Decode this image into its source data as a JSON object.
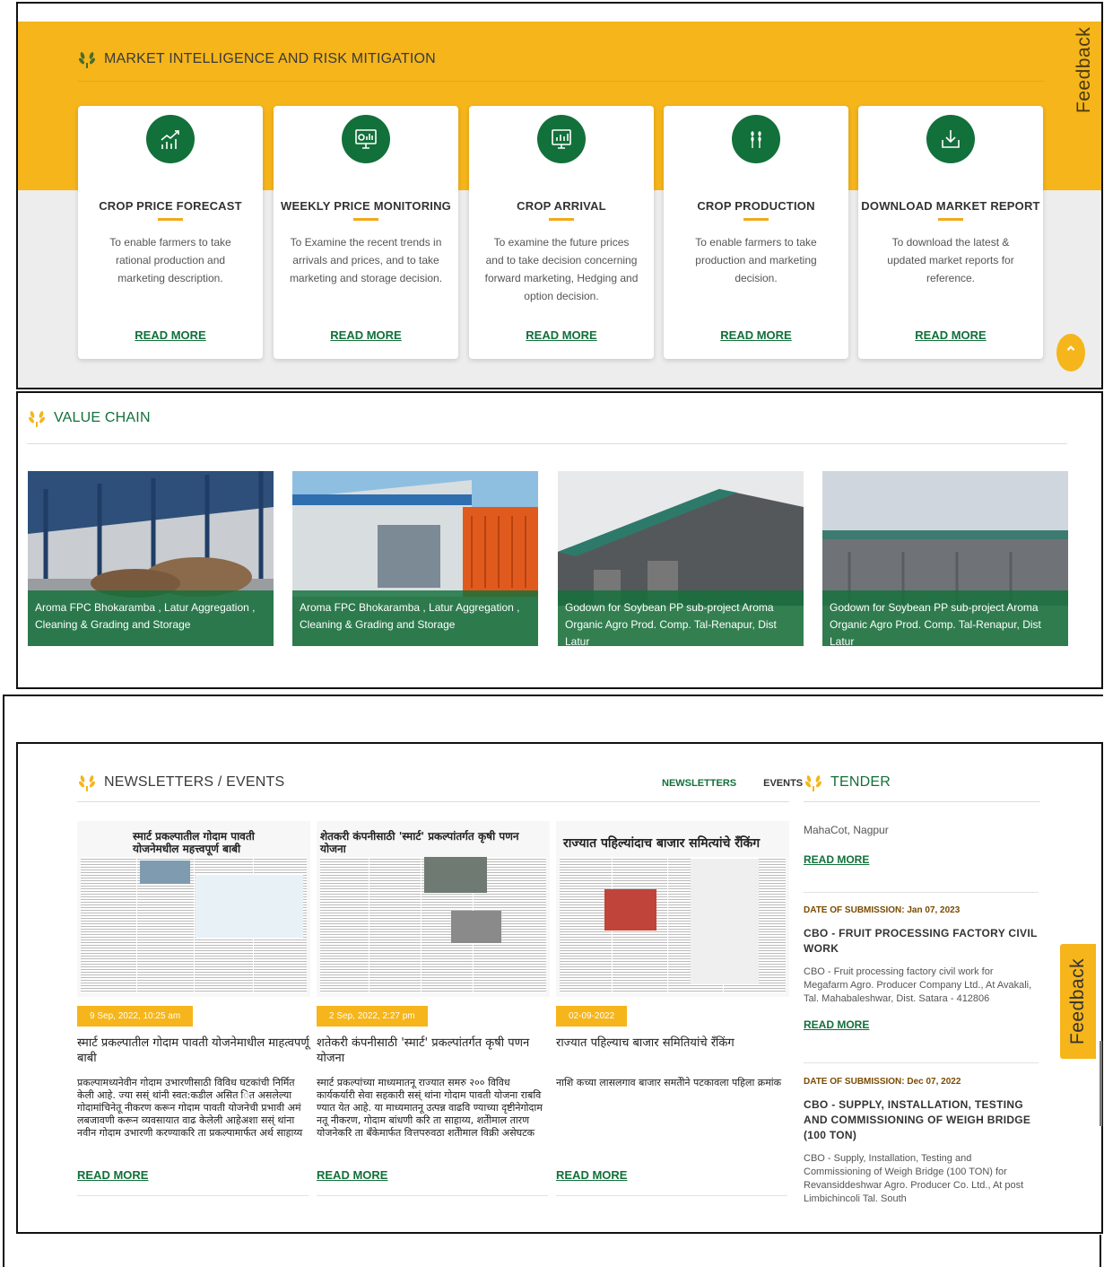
{
  "market": {
    "title": "MARKET INTELLIGENCE AND RISK MITIGATION",
    "cards": [
      {
        "icon": "chart-growth-icon",
        "title": "CROP PRICE FORECAST",
        "desc": "To enable farmers to take rational production and marketing description.",
        "link": "READ MORE"
      },
      {
        "icon": "monitor-chart-icon",
        "title": "WEEKLY PRICE MONITORING",
        "desc": "To Examine the recent trends in arrivals and prices, and to take marketing and storage decision.",
        "link": "READ MORE"
      },
      {
        "icon": "presentation-board-icon",
        "title": "CROP ARRIVAL",
        "desc": "To examine the future prices and to take decision concerning forward marketing, Hedging and option decision.",
        "link": "READ MORE"
      },
      {
        "icon": "wheat-icon",
        "title": "CROP PRODUCTION",
        "desc": "To enable farmers to take production and marketing decision.",
        "link": "READ MORE"
      },
      {
        "icon": "download-tray-icon",
        "title": "DOWNLOAD MARKET REPORT",
        "desc": "To download the latest & updated market reports for reference.",
        "link": "READ MORE"
      }
    ]
  },
  "feedback_label": "Feedback",
  "value_chain": {
    "title": "VALUE CHAIN",
    "items": [
      {
        "caption": "Aroma FPC Bhokaramba , Latur Aggregation , Cleaning & Grading and Storage"
      },
      {
        "caption": "Aroma FPC Bhokaramba , Latur Aggregation , Cleaning & Grading and Storage"
      },
      {
        "caption": "Godown for Soybean PP sub-project Aroma Organic Agro Prod. Comp. Tal-Renapur, Dist Latur"
      },
      {
        "caption": "Godown for Soybean PP sub-project Aroma Organic Agro Prod. Comp. Tal-Renapur, Dist Latur"
      }
    ]
  },
  "newsletters": {
    "title": "NEWSLETTERS / EVENTS",
    "tabs": [
      "NEWSLETTERS",
      "EVENTS"
    ],
    "items": [
      {
        "clip_headline": "स्मार्ट प्रकल्पातील गोदाम पावती योजनेमधील महत्त्वपूर्ण बाबी",
        "date": "9 Sep, 2022, 10:25 am",
        "title": "स्मार्ट प्रकल्पातील गोदाम पावती योजनेमाधील माहत्वपर्णू बाबी",
        "summary": "प्रकल्पामध्यनेवीन गोदाम उभारणीसाठी विविध घटकांची निर्मित केली आहे. ज्या सस्ं थांनी स्वत:कडील असित ित असलेल्या गोदामांचिनेतू नीकरण करून गोदाम पावती योजनेची प्रभावी अमं लबजावणी करून व्यवसायात वाढ केलेली आहेअशा सस्ं थांना नवीन गोदाम उभारणी करण्याकरि ता प्रकल्पामार्फत अर्थ साहाय्य",
        "link": "READ MORE"
      },
      {
        "clip_headline": "शेतकरी कंपनीसाठी 'स्मार्ट' प्रकल्पांतर्गत कृषी पणन योजना",
        "date": "2 Sep, 2022, 2:27 pm",
        "title": "शतेकरी कंपनीसाठी 'स्मार्ट' प्रकल्पांतर्गत कृषी पणन योजना",
        "summary": "स्मार्ट प्रकल्पांच्या माध्यमातनू राज्यात समरु २०० विविध कार्यकर्यारी सेवा सहकारी सस्ं थांना गोदाम पावती योजना राबवि ण्यात येत आहे. या माध्यमातनू उत्पन्न वाढवि ण्याच्या दृष्टीनेगोदाम नतू नीकरण, गोदाम बांधणी करि ता साहाय्य, शतेीमाल तारण योजनेकरि ता बँकेमार्फत वित्तपरुवठा शतेीमाल विक्री असेघटक",
        "link": "READ MORE"
      },
      {
        "clip_headline": "राज्यात पहिल्यांदाच बाजार समित्यांचे रँकिंग",
        "date": "02-09-2022",
        "title": "राज्यात पहिल्याच बाजार समितियांचे रँकिंग",
        "summary": "नाशि कच्या लासलगाव बाजार समतेीने पटकावला पहिला क्रमांक",
        "link": "READ MORE"
      }
    ]
  },
  "tender": {
    "title": "TENDER",
    "first": {
      "desc": "MahaCot, Nagpur",
      "link": "READ MORE"
    },
    "items": [
      {
        "date": "DATE OF SUBMISSION: Jan 07, 2023",
        "title": "CBO - FRUIT PROCESSING FACTORY CIVIL WORK",
        "desc": "CBO - Fruit processing factory civil work for Megafarm Agro. Producer Company Ltd., At Avakali, Tal. Mahabaleshwar, Dist. Satara - 412806",
        "link": "READ MORE"
      },
      {
        "date": "DATE OF SUBMISSION: Dec 07, 2022",
        "title": "CBO - SUPPLY, INSTALLATION, TESTING AND COMMISSIONING OF WEIGH BRIDGE (100 TON)",
        "desc": "CBO - Supply, Installation, Testing and Commissioning of Weigh Bridge (100 TON) for Revansiddeshwar Agro. Producer Co. Ltd., At post Limbichincoli Tal. South"
      }
    ]
  },
  "colors": {
    "brand_green": "#12703a",
    "accent_yellow": "#f5b51b"
  }
}
